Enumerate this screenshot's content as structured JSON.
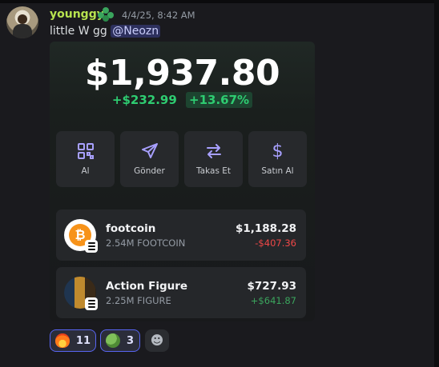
{
  "message": {
    "author": "younggy",
    "timestamp": "4/4/25, 8:42 AM",
    "text": "little W gg",
    "mention": "@Neozn"
  },
  "wallet": {
    "balance": "$1,937.80",
    "change_abs": "+$232.99",
    "change_pct": "+13.67%",
    "actions": [
      {
        "label": "Al",
        "icon": "qr-code-icon"
      },
      {
        "label": "Gönder",
        "icon": "send-icon"
      },
      {
        "label": "Takas Et",
        "icon": "swap-icon"
      },
      {
        "label": "Satın Al",
        "icon": "dollar-icon"
      }
    ],
    "tokens": [
      {
        "name": "footcoin",
        "amount": "2.54M FOOTCOIN",
        "value": "$1,188.28",
        "change": "-$407.36",
        "icon": "footcoin-logo-icon"
      },
      {
        "name": "Action Figure",
        "amount": "2.25M FIGURE",
        "value": "$727.93",
        "change": "+$641.87",
        "icon": "action-figure-logo-icon"
      }
    ]
  },
  "reactions": [
    {
      "emoji": "fire-emoji",
      "count": "11"
    },
    {
      "emoji": "pepe-emoji",
      "count": "3"
    }
  ],
  "colors": {
    "username": "#b7e34f",
    "accent": "#5865f2",
    "positive": "#2ecc71",
    "negative": "#f04747",
    "action_icon": "#a8a0ff"
  }
}
